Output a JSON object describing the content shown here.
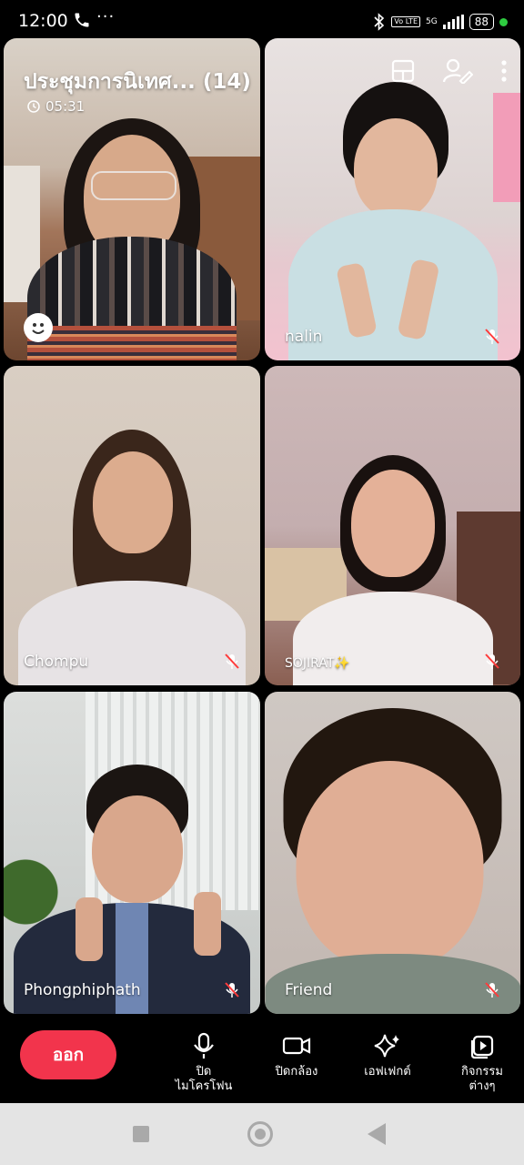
{
  "status_bar": {
    "time": "12:00",
    "more": "···",
    "volte": "Vo LTE",
    "network": "5G",
    "battery": "88"
  },
  "meeting": {
    "title": "ประชุมการนิเทศ... (14)",
    "duration": "05:31"
  },
  "participants": [
    {
      "name": "",
      "muted": false
    },
    {
      "name": "nalin",
      "muted": true
    },
    {
      "name": "Chompu",
      "muted": true
    },
    {
      "name": "SOJIRAT✨",
      "muted": true
    },
    {
      "name": "Phongphiphath",
      "muted": true
    },
    {
      "name": "Friend",
      "muted": true
    }
  ],
  "controls": {
    "leave": "ออก",
    "mic_line1": "ปิด",
    "mic_line2": "ไมโครโฟน",
    "camera": "ปิดกล้อง",
    "effects": "เอฟเฟกต์",
    "activities_line1": "กิจกรรม",
    "activities_line2": "ต่างๆ"
  },
  "icons": [
    "phone-icon",
    "bluetooth-icon",
    "signal-icon",
    "clock-icon",
    "layout-icon",
    "edit-user-icon",
    "more-vert-icon",
    "emoji-icon",
    "mic-muted-icon",
    "mic-icon",
    "camera-icon",
    "sparkle-icon",
    "activity-icon"
  ]
}
